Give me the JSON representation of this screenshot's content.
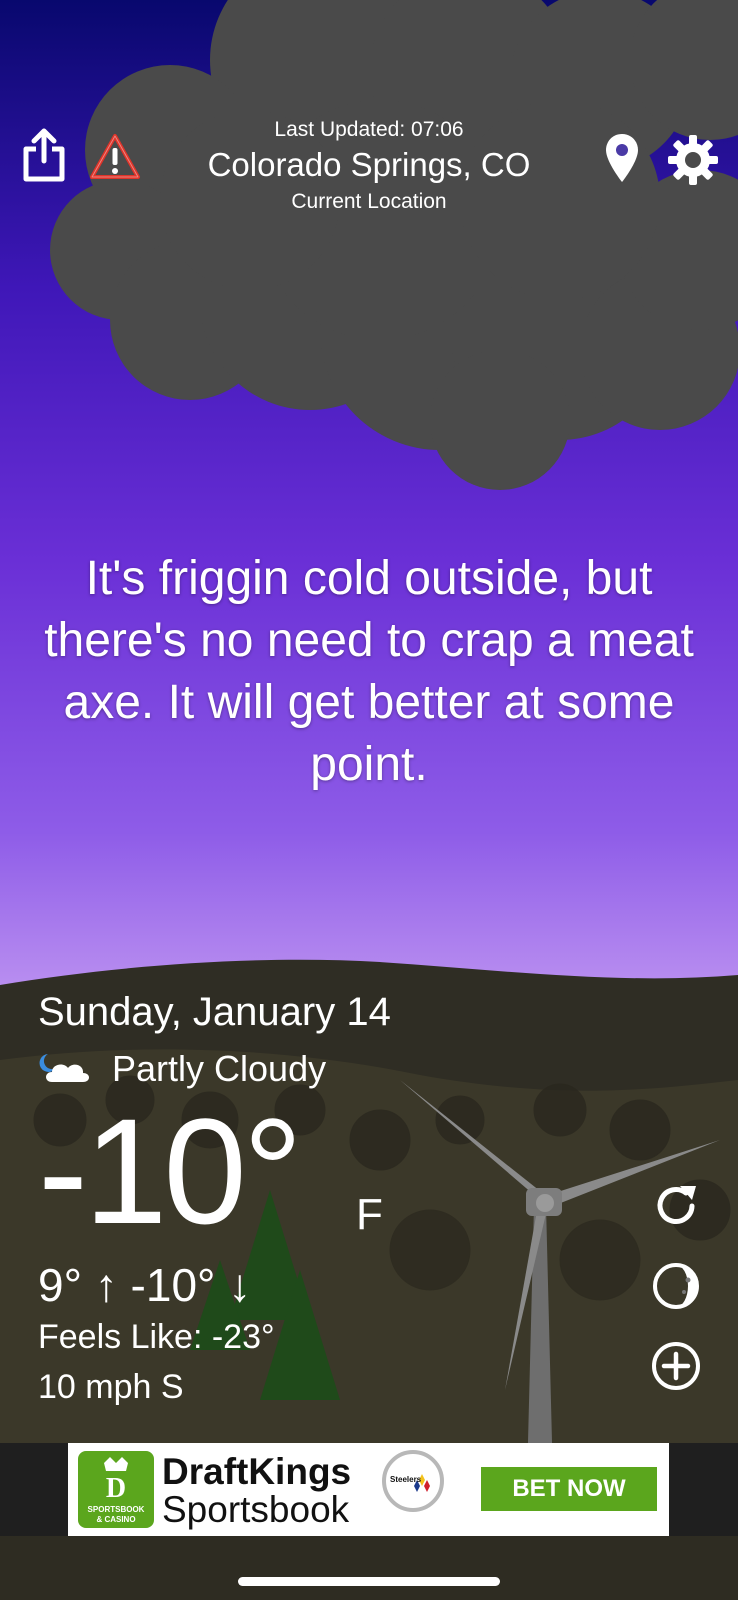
{
  "header": {
    "last_updated": "Last Updated: 07:06",
    "location_name": "Colorado Springs, CO",
    "location_type": "Current Location",
    "icons": [
      "share-icon",
      "alert-icon",
      "location-pin-icon",
      "settings-gear-icon"
    ]
  },
  "message": "It's friggin cold outside, but there's no need to crap a meat axe. It will get better at some point.",
  "weather": {
    "date": "Sunday, January 14",
    "condition_icon": "moon-cloud-icon",
    "condition": "Partly Cloudy",
    "temperature": "-10°",
    "unit": "F",
    "high_low": "9° ↑  -10° ↓",
    "feels_like": "Feels Like: -23°",
    "wind": "10 mph S"
  },
  "side_actions": [
    "refresh-icon",
    "moon-phase-icon",
    "add-location-icon"
  ],
  "ad": {
    "badge_top": "SPORTSBOOK",
    "badge_bottom": "& CASINO",
    "brand": "DraftKings",
    "product": "Sportsbook",
    "team_logo_text": "Steelers",
    "cta": "BET NOW"
  },
  "colors": {
    "sky_top": "#08086e",
    "sky_mid": "#7a3ee0",
    "sky_bottom": "#c39af2",
    "cloud": "#4a4a4a",
    "ground": "#2e2c22",
    "alert_red": "#e0342a",
    "ad_green": "#5ba61d",
    "ad_bar": "#1f1f1f"
  }
}
